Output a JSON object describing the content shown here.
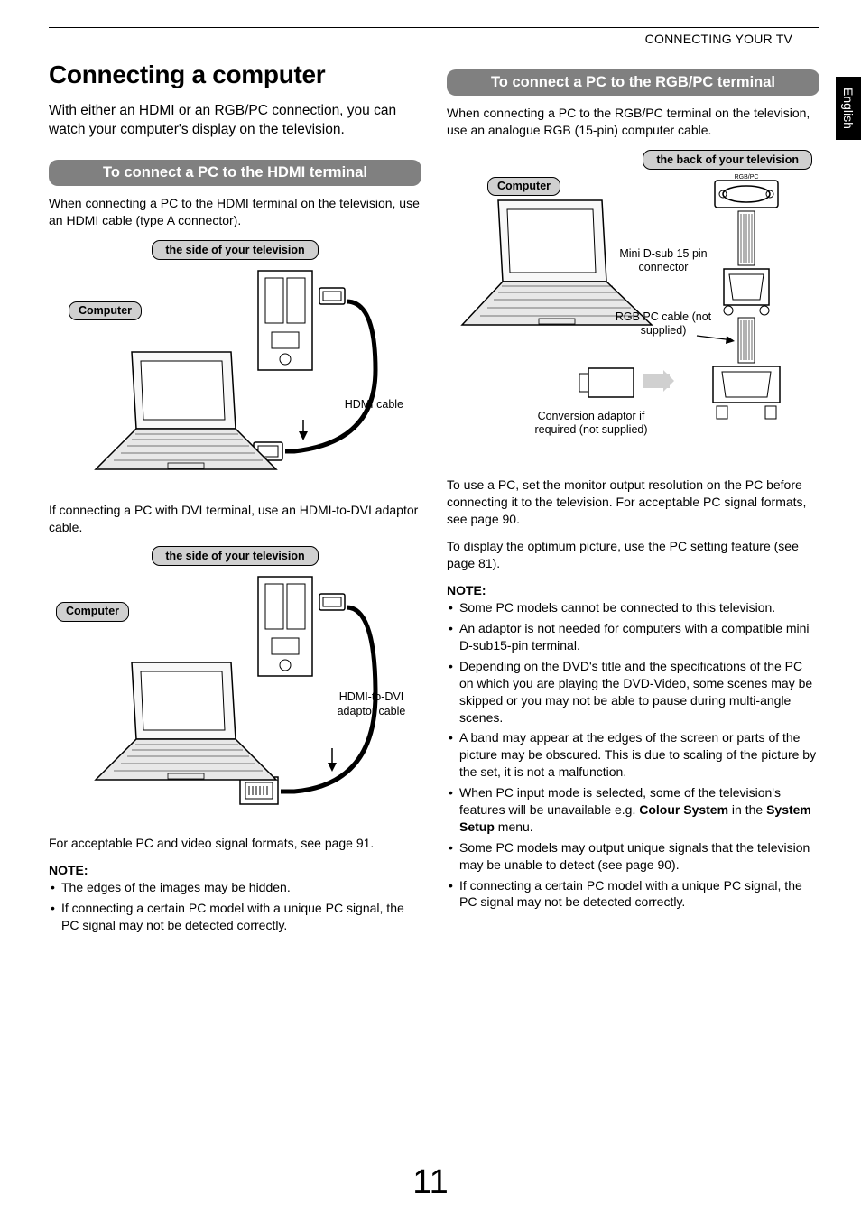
{
  "header": {
    "breadcrumb": "CONNECTING YOUR TV",
    "lang_tab": "English"
  },
  "left": {
    "title": "Connecting a computer",
    "intro": "With either an HDMI or an RGB/PC connection, you can watch your computer's display on the television.",
    "section1": {
      "heading": "To connect a PC to the HDMI terminal",
      "body": "When connecting a PC to the HDMI terminal on the television, use an HDMI cable (type A connector).",
      "fig_label": "the side of your television",
      "annot_computer": "Computer",
      "annot_cable": "HDMI cable"
    },
    "dvi_para": "If connecting a PC with DVI terminal, use an HDMI-to-DVI adaptor cable.",
    "fig2": {
      "label": "the side of your television",
      "annot_computer": "Computer",
      "annot_cable": "HDMI-to-DVI adaptor cable"
    },
    "formats_para": "For acceptable PC and video signal formats, see page 91.",
    "note_heading": "NOTE:",
    "notes": [
      "The edges of the images may be hidden.",
      "If connecting a certain PC model with a unique PC signal, the PC signal may not be detected correctly."
    ]
  },
  "right": {
    "section_heading": "To connect a PC to the RGB/PC terminal",
    "body": "When connecting a PC to the RGB/PC terminal on the television, use an analogue RGB (15-pin) computer cable.",
    "fig": {
      "label": "the back of your television",
      "annot_computer": "Computer",
      "annot_mini": "Mini D-sub 15 pin connector",
      "annot_rgb": "RGB PC cable (not supplied)",
      "annot_conv": "Conversion adaptor if required (not supplied)",
      "port_label": "RGB/PC"
    },
    "para1": "To use a PC, set the monitor output resolution on the PC before connecting it to the television. For acceptable PC signal formats, see page 90.",
    "para2": "To display the optimum picture, use the PC setting feature (see page 81).",
    "note_heading": "NOTE:",
    "notes": [
      "Some PC models cannot be connected to this television.",
      "An adaptor is not needed for computers with a compatible mini D-sub15-pin terminal.",
      "Depending on the DVD's title and the specifications of the PC on which you are playing the DVD-Video, some scenes may be skipped or you may not be able to pause during multi-angle scenes.",
      "A band may appear at the edges of the screen or parts of the picture may be obscured. This is due to scaling of the picture by the set, it is not a malfunction.",
      "When PC input mode is selected, some of the television's features will be unavailable e.g. Colour System in the System Setup menu.",
      "Some PC models may output unique signals that the television may be unable to detect (see page 90).",
      "If connecting a certain PC model with a unique PC signal, the PC signal may not be detected correctly."
    ]
  },
  "page_number": "11"
}
